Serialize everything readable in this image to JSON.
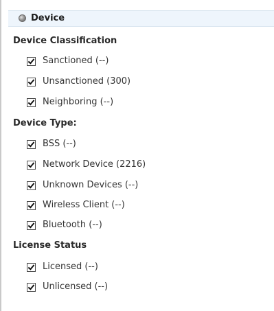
{
  "header": {
    "title": "Device",
    "icon": "status-dot-icon"
  },
  "sections": [
    {
      "title": "Device Classification",
      "items": [
        {
          "label": "Sanctioned (--)",
          "checked": true
        },
        {
          "label": "Unsanctioned (300)",
          "checked": true
        },
        {
          "label": "Neighboring (--)",
          "checked": true
        }
      ]
    },
    {
      "title": "Device Type:",
      "items": [
        {
          "label": "BSS (--)",
          "checked": true
        },
        {
          "label": "Network Device (2216)",
          "checked": true
        },
        {
          "label": "Unknown Devices (--)",
          "checked": true
        },
        {
          "label": "Wireless Client (--)",
          "checked": true
        },
        {
          "label": "Bluetooth (--)",
          "checked": true
        }
      ]
    },
    {
      "title": "License Status",
      "items": [
        {
          "label": "Licensed (--)",
          "checked": true
        },
        {
          "label": "Unlicensed (--)",
          "checked": true
        }
      ]
    }
  ]
}
